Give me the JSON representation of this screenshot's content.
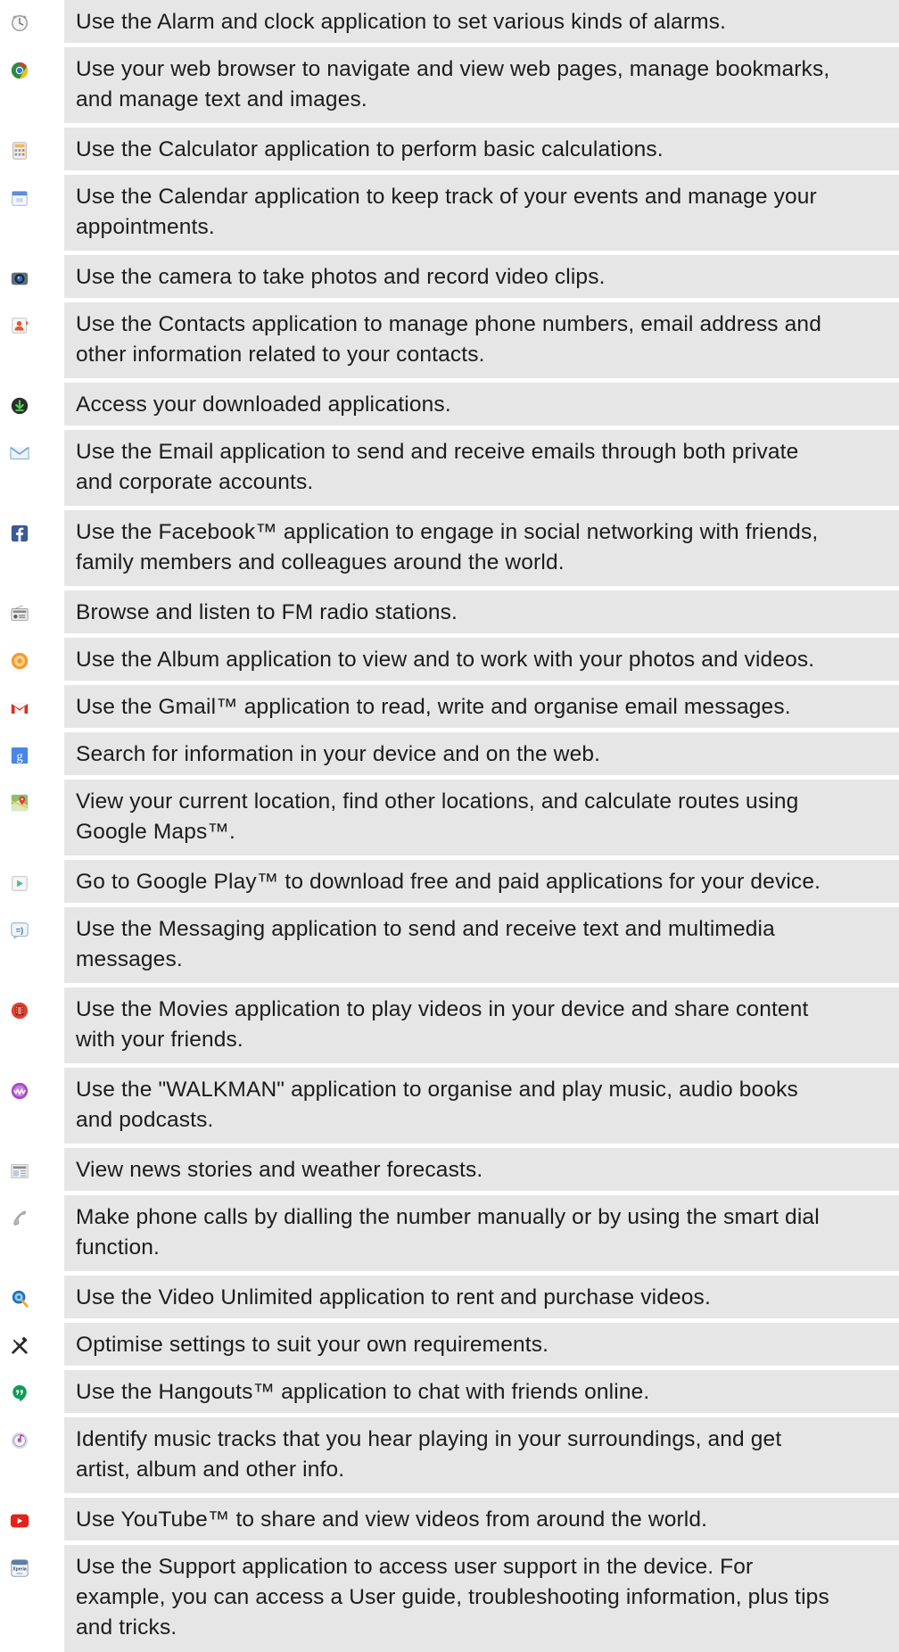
{
  "app_list": [
    {
      "icon": "alarm-clock-icon",
      "lines": [
        "Use the Alarm and clock application to set various kinds of alarms."
      ]
    },
    {
      "icon": "web-browser-icon",
      "lines": [
        "Use your web browser to navigate and view web pages, manage bookmarks,",
        "and manage text and images."
      ]
    },
    {
      "icon": "calculator-icon",
      "lines": [
        "Use the Calculator application to perform basic calculations."
      ]
    },
    {
      "icon": "calendar-icon",
      "lines": [
        "Use the Calendar application to keep track of your events and manage your",
        "appointments."
      ]
    },
    {
      "icon": "camera-icon",
      "lines": [
        "Use the camera to take photos and record video clips."
      ]
    },
    {
      "icon": "contacts-icon",
      "lines": [
        "Use the Contacts application to manage phone numbers, email address and",
        "other information related to your contacts."
      ]
    },
    {
      "icon": "downloads-icon",
      "lines": [
        "Access your downloaded applications."
      ]
    },
    {
      "icon": "email-icon",
      "lines": [
        "Use the Email application to send and receive emails through both private",
        "and corporate accounts."
      ]
    },
    {
      "icon": "facebook-icon",
      "lines": [
        "Use the Facebook™ application to engage in social networking with friends,",
        "family members and colleagues around the world."
      ]
    },
    {
      "icon": "fm-radio-icon",
      "lines": [
        "Browse and listen to FM radio stations."
      ]
    },
    {
      "icon": "album-icon",
      "lines": [
        "Use the Album application to view and to work with your photos and videos."
      ]
    },
    {
      "icon": "gmail-icon",
      "lines": [
        "Use the Gmail™ application to read, write and organise email messages."
      ]
    },
    {
      "icon": "google-search-icon",
      "lines": [
        "Search for information in your device and on the web."
      ]
    },
    {
      "icon": "google-maps-icon",
      "lines": [
        "View your current location, find other locations, and calculate routes using",
        "Google Maps™."
      ]
    },
    {
      "icon": "google-play-icon",
      "lines": [
        "Go to Google Play™ to download free and paid applications for your device."
      ]
    },
    {
      "icon": "messaging-icon",
      "lines": [
        "Use the Messaging application to send and receive text and multimedia",
        "messages."
      ]
    },
    {
      "icon": "movies-icon",
      "lines": [
        "Use the Movies application to play videos in your device and share content",
        "with your friends."
      ]
    },
    {
      "icon": "walkman-icon",
      "lines": [
        "Use the \"WALKMAN\" application to organise and play music, audio books",
        "and podcasts."
      ]
    },
    {
      "icon": "news-weather-icon",
      "lines": [
        "View news stories and weather forecasts."
      ]
    },
    {
      "icon": "phone-icon",
      "lines": [
        "Make phone calls by dialling the number manually or by using the smart dial",
        "function."
      ]
    },
    {
      "icon": "video-unlimited-icon",
      "lines": [
        "Use the Video Unlimited application to rent and purchase videos."
      ]
    },
    {
      "icon": "settings-tools-icon",
      "lines": [
        "Optimise settings to suit your own requirements."
      ]
    },
    {
      "icon": "hangouts-icon",
      "lines": [
        "Use the Hangouts™ application to chat with friends online."
      ]
    },
    {
      "icon": "trackid-icon",
      "lines": [
        "Identify music tracks that you hear playing in your surroundings, and get",
        "artist, album and other info."
      ]
    },
    {
      "icon": "youtube-icon",
      "lines": [
        "Use YouTube™ to share and view videos from around the world."
      ]
    },
    {
      "icon": "xperia-support-icon",
      "lines": [
        "Use the Support application to access user support in the device. For",
        "example, you can access a User guide, troubleshooting information, plus tips",
        "and tricks."
      ]
    }
  ]
}
